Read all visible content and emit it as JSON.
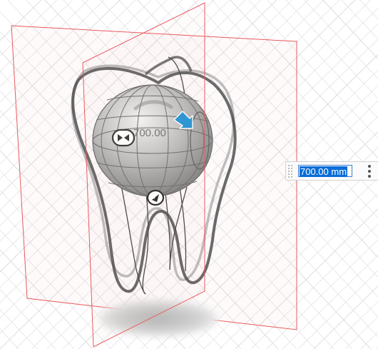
{
  "canvas_label": "700.00",
  "dimension_input": {
    "value": "700.00 mm"
  },
  "icons": {
    "move_arrow": "arrow-icon",
    "more_menu": "vertical-ellipsis-icon",
    "drag_grip": "grip-icon"
  },
  "colors": {
    "grid_line": "#dcdde2",
    "section_plane": "#e8484b",
    "selection": "#0a6dd8",
    "manipulator_arrow": "#2a97d6"
  }
}
